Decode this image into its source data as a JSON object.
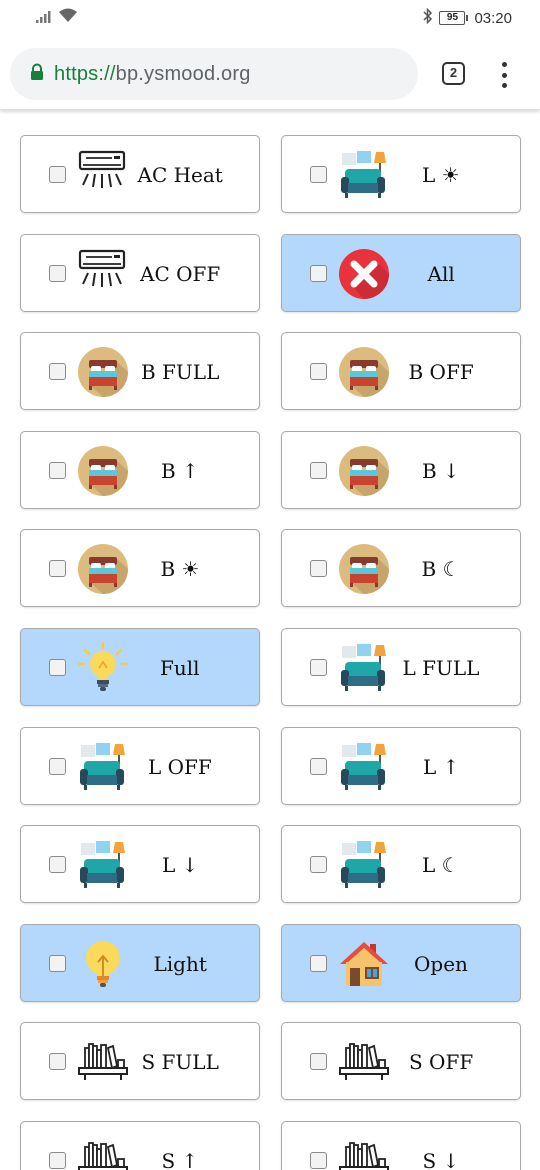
{
  "status_bar": {
    "battery": "95",
    "time": "03:20"
  },
  "browser": {
    "url_scheme": "https://",
    "url_host": "bp.ysmood.org",
    "tab_count": "2"
  },
  "colors": {
    "active_tile": "#b3d8fc",
    "tile_border": "#a9a9a9",
    "secure_green": "#188038"
  },
  "tiles": [
    {
      "label": "AC Heat",
      "icon": "air-conditioner-icon",
      "active": false
    },
    {
      "label": "L ☀",
      "icon": "living-room-icon",
      "active": false
    },
    {
      "label": "AC OFF",
      "icon": "air-conditioner-icon",
      "active": false
    },
    {
      "label": "All",
      "icon": "close-circle-icon",
      "active": true
    },
    {
      "label": "B FULL",
      "icon": "bed-icon",
      "active": false
    },
    {
      "label": "B OFF",
      "icon": "bed-icon",
      "active": false
    },
    {
      "label": "B ↑",
      "icon": "bed-icon",
      "active": false
    },
    {
      "label": "B ↓",
      "icon": "bed-icon",
      "active": false
    },
    {
      "label": "B ☀",
      "icon": "bed-icon",
      "active": false
    },
    {
      "label": "B ☾",
      "icon": "bed-icon",
      "active": false
    },
    {
      "label": "Full",
      "icon": "lightbulb-on-icon",
      "active": true
    },
    {
      "label": "L FULL",
      "icon": "living-room-icon",
      "active": false
    },
    {
      "label": "L OFF",
      "icon": "living-room-icon",
      "active": false
    },
    {
      "label": "L ↑",
      "icon": "living-room-icon",
      "active": false
    },
    {
      "label": "L ↓",
      "icon": "living-room-icon",
      "active": false
    },
    {
      "label": "L ☾",
      "icon": "living-room-icon",
      "active": false
    },
    {
      "label": "Light",
      "icon": "lightbulb-icon",
      "active": true
    },
    {
      "label": "Open",
      "icon": "house-icon",
      "active": true
    },
    {
      "label": "S FULL",
      "icon": "bookshelf-icon",
      "active": false
    },
    {
      "label": "S OFF",
      "icon": "bookshelf-icon",
      "active": false
    },
    {
      "label": "S ↑",
      "icon": "bookshelf-icon",
      "active": false
    },
    {
      "label": "S ↓",
      "icon": "bookshelf-icon",
      "active": false
    }
  ]
}
